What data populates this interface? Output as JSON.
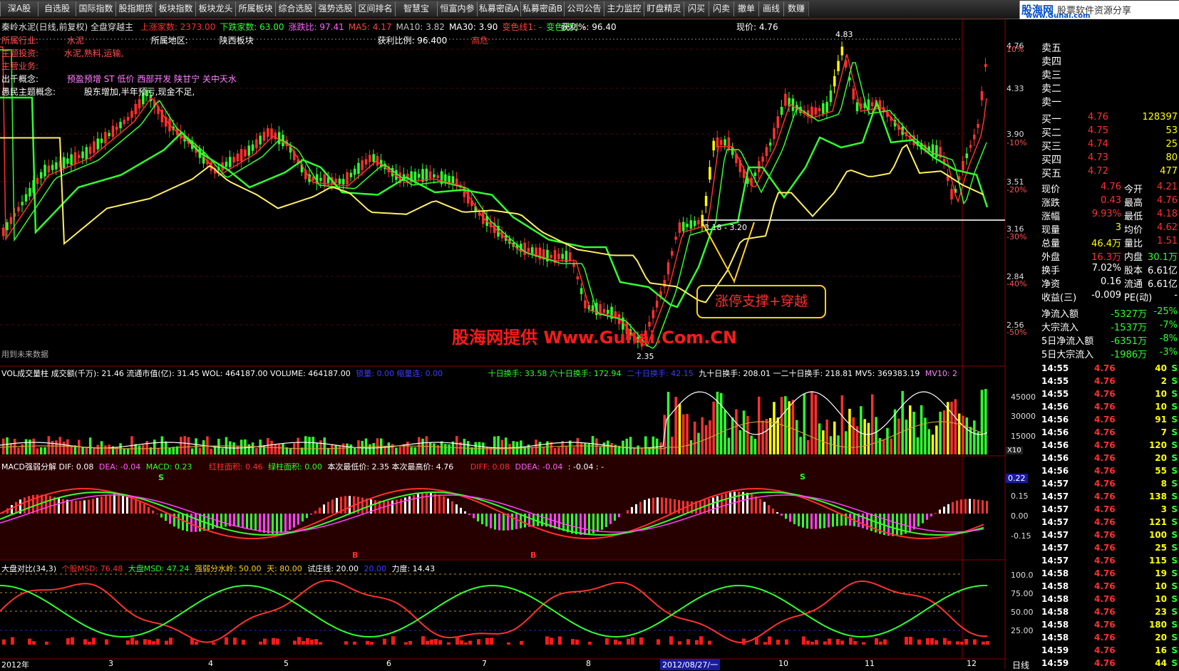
{
  "toolbar": {
    "items": [
      "深A股",
      "自选股",
      "国际指数",
      "股指期货",
      "板块指数",
      "板块龙头",
      "所属板块",
      "综合选股",
      "强势选股",
      "区间排名",
      "智慧宝",
      "恒富内参",
      "私募密函A",
      "私募密函B",
      "公司公告",
      "主力监控",
      "盯盘精灵",
      "闪买",
      "闪卖",
      "撤单",
      "画线",
      "数赚"
    ]
  },
  "brand": {
    "name": "股海网",
    "slogan": "股票软件资源分享",
    "url": "www.Guhai.com"
  },
  "main": {
    "title": "秦岭水泥(日线,前复权) 全盘穿越主",
    "stats": [
      {
        "label": "上涨家数:",
        "value": "2373.00",
        "color": "#ff3030"
      },
      {
        "label": "下跌家数:",
        "value": "63.00",
        "color": "#30ff30"
      },
      {
        "label": "涨跌比:",
        "value": "97.41",
        "color": "#ff60ff"
      },
      {
        "label": "MA5:",
        "value": "4.17",
        "color": "#ff4040"
      },
      {
        "label": "MA10:",
        "value": "3.82",
        "color": "#c0c0c0"
      },
      {
        "label": "MA30:",
        "value": "3.90",
        "color": "#ffffff"
      },
      {
        "label": "变色线1:",
        "value": "-",
        "color": "#ff4040"
      },
      {
        "label": "变色线2:",
        "value": "-",
        "color": "#30ff30"
      }
    ],
    "profit": "获利%: 96.40",
    "price_now": "现价: 4.76",
    "info": {
      "industry_label": "所属行业:",
      "industry": "水泥",
      "region_label": "所属地区:",
      "region": "陕西板块",
      "profit_ratio": "获利比例: 96.400",
      "tag": "高危",
      "theme_label": "主题投资:",
      "theme": "水泥,熟料,运输,",
      "business_label": "主营业务:",
      "concept_label": "出千概念:",
      "concept": "预盈预增 ST 低价 西部开发 陕甘宁 关中天水",
      "worry_label": "愚民主题概念:",
      "worry": "股东增加,半年预亏,现金不足,"
    },
    "annotations": {
      "high": "4.83",
      "low": "2.35",
      "range": "3.18 - 3.20",
      "callout": "涨停支撑+穿越",
      "watermark": "股海网提供 Www.Guhai.Com.CN",
      "future": "用到未来数据"
    },
    "price_axis": [
      "4.76",
      "4.33",
      "3.90",
      "3.51",
      "3.16",
      "2.84",
      "2.56"
    ],
    "pct_axis": [
      "10%",
      "-10%",
      "-20%",
      "-30%",
      "-40%",
      "-50%"
    ]
  },
  "volume": {
    "header": "VOL成交量柱  成交额(千万): 21.46  流通市值(亿): 31.45  WOL: 464187.00  VOLUME: 464187.00",
    "header2": "锁量: 0.00  缩量连: 0.00",
    "header3": "十日换手: 33.58  六十日换手: 172.94",
    "header4": "二十日换手: 42.15",
    "header5": "九十日换手: 208.01  一二十日换手: 218.81  MV5: 369383.19",
    "header6": "MV10: 2",
    "axis": [
      "45000",
      "30000",
      "15000"
    ],
    "unit": "X10"
  },
  "macd": {
    "header": "MACD强弱分解  DIF: 0.08",
    "dea": "DEA: -0.04",
    "macd": "MACD: 0.23",
    "red_area": "红柱面积: 0.46",
    "green_area": "绿柱面积: 0.00",
    "low": "本次最低价: 2.35  本次最高价: 4.76",
    "diff": "DIFF: 0.08",
    "ddea": "DDEA: -0.04",
    "extra": ": -0.04 : -",
    "axis": [
      "0.22",
      "0.15",
      "0.00",
      "-0.15"
    ],
    "marks": [
      "S",
      "S",
      "B",
      "B"
    ]
  },
  "msd": {
    "header": "大盘对比(34,3)",
    "stock": "个股MSD: 76.48",
    "market": "大盘MSD: 47.24",
    "water": "强弱分水岭: 50.00",
    "sky": "天: 80.00",
    "test": "试庄线: 20.00",
    "blue": "20.00",
    "force": "力度: 14.43",
    "axis": [
      "100.0",
      "75.00",
      "50.00",
      "25.00"
    ]
  },
  "xaxis": {
    "labels": [
      "2012年",
      "3",
      "4",
      "5",
      "6",
      "7",
      "8",
      "2012/08/27/一",
      "10",
      "11",
      "12"
    ],
    "period": "日线"
  },
  "quote": {
    "sell": [
      {
        "label": "卖五",
        "price": "",
        "vol": ""
      },
      {
        "label": "卖四",
        "price": "",
        "vol": ""
      },
      {
        "label": "卖三",
        "price": "",
        "vol": ""
      },
      {
        "label": "卖二",
        "price": "",
        "vol": ""
      },
      {
        "label": "卖一",
        "price": "",
        "vol": ""
      }
    ],
    "buy": [
      {
        "label": "买一",
        "price": "4.76",
        "vol": "128397"
      },
      {
        "label": "买二",
        "price": "4.75",
        "vol": "53"
      },
      {
        "label": "买三",
        "price": "4.74",
        "vol": "25"
      },
      {
        "label": "买四",
        "price": "4.73",
        "vol": "80"
      },
      {
        "label": "买五",
        "price": "4.72",
        "vol": "477"
      }
    ],
    "stats": [
      {
        "l1": "现价",
        "v1": "4.76",
        "l2": "今开",
        "v2": "4.21",
        "c1": "#ff3030",
        "c2": "#ff3030"
      },
      {
        "l1": "涨跌",
        "v1": "0.43",
        "l2": "最高",
        "v2": "4.76",
        "c1": "#ff3030",
        "c2": "#ff3030"
      },
      {
        "l1": "涨幅",
        "v1": "9.93%",
        "l2": "最低",
        "v2": "4.18",
        "c1": "#ff3030",
        "c2": "#ff3030"
      },
      {
        "l1": "现量",
        "v1": "3",
        "l2": "均价",
        "v2": "4.62",
        "c1": "#ffff00",
        "c2": "#ff3030"
      },
      {
        "l1": "总量",
        "v1": "46.4万",
        "l2": "量比",
        "v2": "1.51",
        "c1": "#ffff00",
        "c2": "#ff3030"
      },
      {
        "l1": "外盘",
        "v1": "16.3万",
        "l2": "内盘",
        "v2": "30.1万",
        "c1": "#ff3030",
        "c2": "#30ff30"
      },
      {
        "l1": "换手",
        "v1": "7.02%",
        "l2": "股本",
        "v2": "6.61亿",
        "c1": "#ffffff",
        "c2": "#ffffff"
      },
      {
        "l1": "净资",
        "v1": "0.16",
        "l2": "流通",
        "v2": "6.61亿",
        "c1": "#ffffff",
        "c2": "#ffffff"
      },
      {
        "l1": "收益(三)",
        "v1": "-0.009",
        "l2": "PE(动)",
        "v2": "-",
        "c1": "#ffffff",
        "c2": "#ffffff"
      }
    ],
    "flows": [
      {
        "label": "净流入额",
        "v1": "-5327万",
        "v2": "-25%"
      },
      {
        "label": "大宗流入",
        "v1": "-1537万",
        "v2": "-7%"
      },
      {
        "label": "5日净流入额",
        "v1": "-6351万",
        "v2": "-8%"
      },
      {
        "label": "5日大宗流入",
        "v1": "-1986万",
        "v2": "-3%"
      }
    ],
    "ticks": [
      {
        "t": "14:55",
        "p": "4.76",
        "v": "40",
        "s": "S"
      },
      {
        "t": "14:55",
        "p": "4.76",
        "v": "2",
        "s": "S"
      },
      {
        "t": "14:55",
        "p": "4.76",
        "v": "10",
        "s": "S"
      },
      {
        "t": "14:56",
        "p": "4.76",
        "v": "10",
        "s": "S"
      },
      {
        "t": "14:56",
        "p": "4.76",
        "v": "91",
        "s": "S"
      },
      {
        "t": "14:56",
        "p": "4.76",
        "v": "7",
        "s": "S"
      },
      {
        "t": "14:56",
        "p": "4.76",
        "v": "120",
        "s": "S"
      },
      {
        "t": "14:56",
        "p": "4.76",
        "v": "20",
        "s": "S"
      },
      {
        "t": "14:56",
        "p": "4.76",
        "v": "55",
        "s": "S"
      },
      {
        "t": "14:57",
        "p": "4.76",
        "v": "8",
        "s": "S"
      },
      {
        "t": "14:57",
        "p": "4.76",
        "v": "138",
        "s": "S"
      },
      {
        "t": "14:57",
        "p": "4.76",
        "v": "3",
        "s": "S"
      },
      {
        "t": "14:57",
        "p": "4.76",
        "v": "121",
        "s": "S"
      },
      {
        "t": "14:57",
        "p": "4.76",
        "v": "100",
        "s": "S"
      },
      {
        "t": "14:57",
        "p": "4.76",
        "v": "25",
        "s": "S"
      },
      {
        "t": "14:57",
        "p": "4.76",
        "v": "115",
        "s": "S"
      },
      {
        "t": "14:58",
        "p": "4.76",
        "v": "19",
        "s": "S"
      },
      {
        "t": "14:58",
        "p": "4.76",
        "v": "10",
        "s": "S"
      },
      {
        "t": "14:58",
        "p": "4.76",
        "v": "10",
        "s": "S"
      },
      {
        "t": "14:58",
        "p": "4.76",
        "v": "23",
        "s": "S"
      },
      {
        "t": "14:58",
        "p": "4.76",
        "v": "180",
        "s": "S"
      },
      {
        "t": "14:58",
        "p": "4.76",
        "v": "20",
        "s": "S"
      },
      {
        "t": "14:59",
        "p": "4.76",
        "v": "16",
        "s": "S"
      },
      {
        "t": "14:59",
        "p": "4.76",
        "v": "44",
        "s": "S"
      }
    ]
  }
}
